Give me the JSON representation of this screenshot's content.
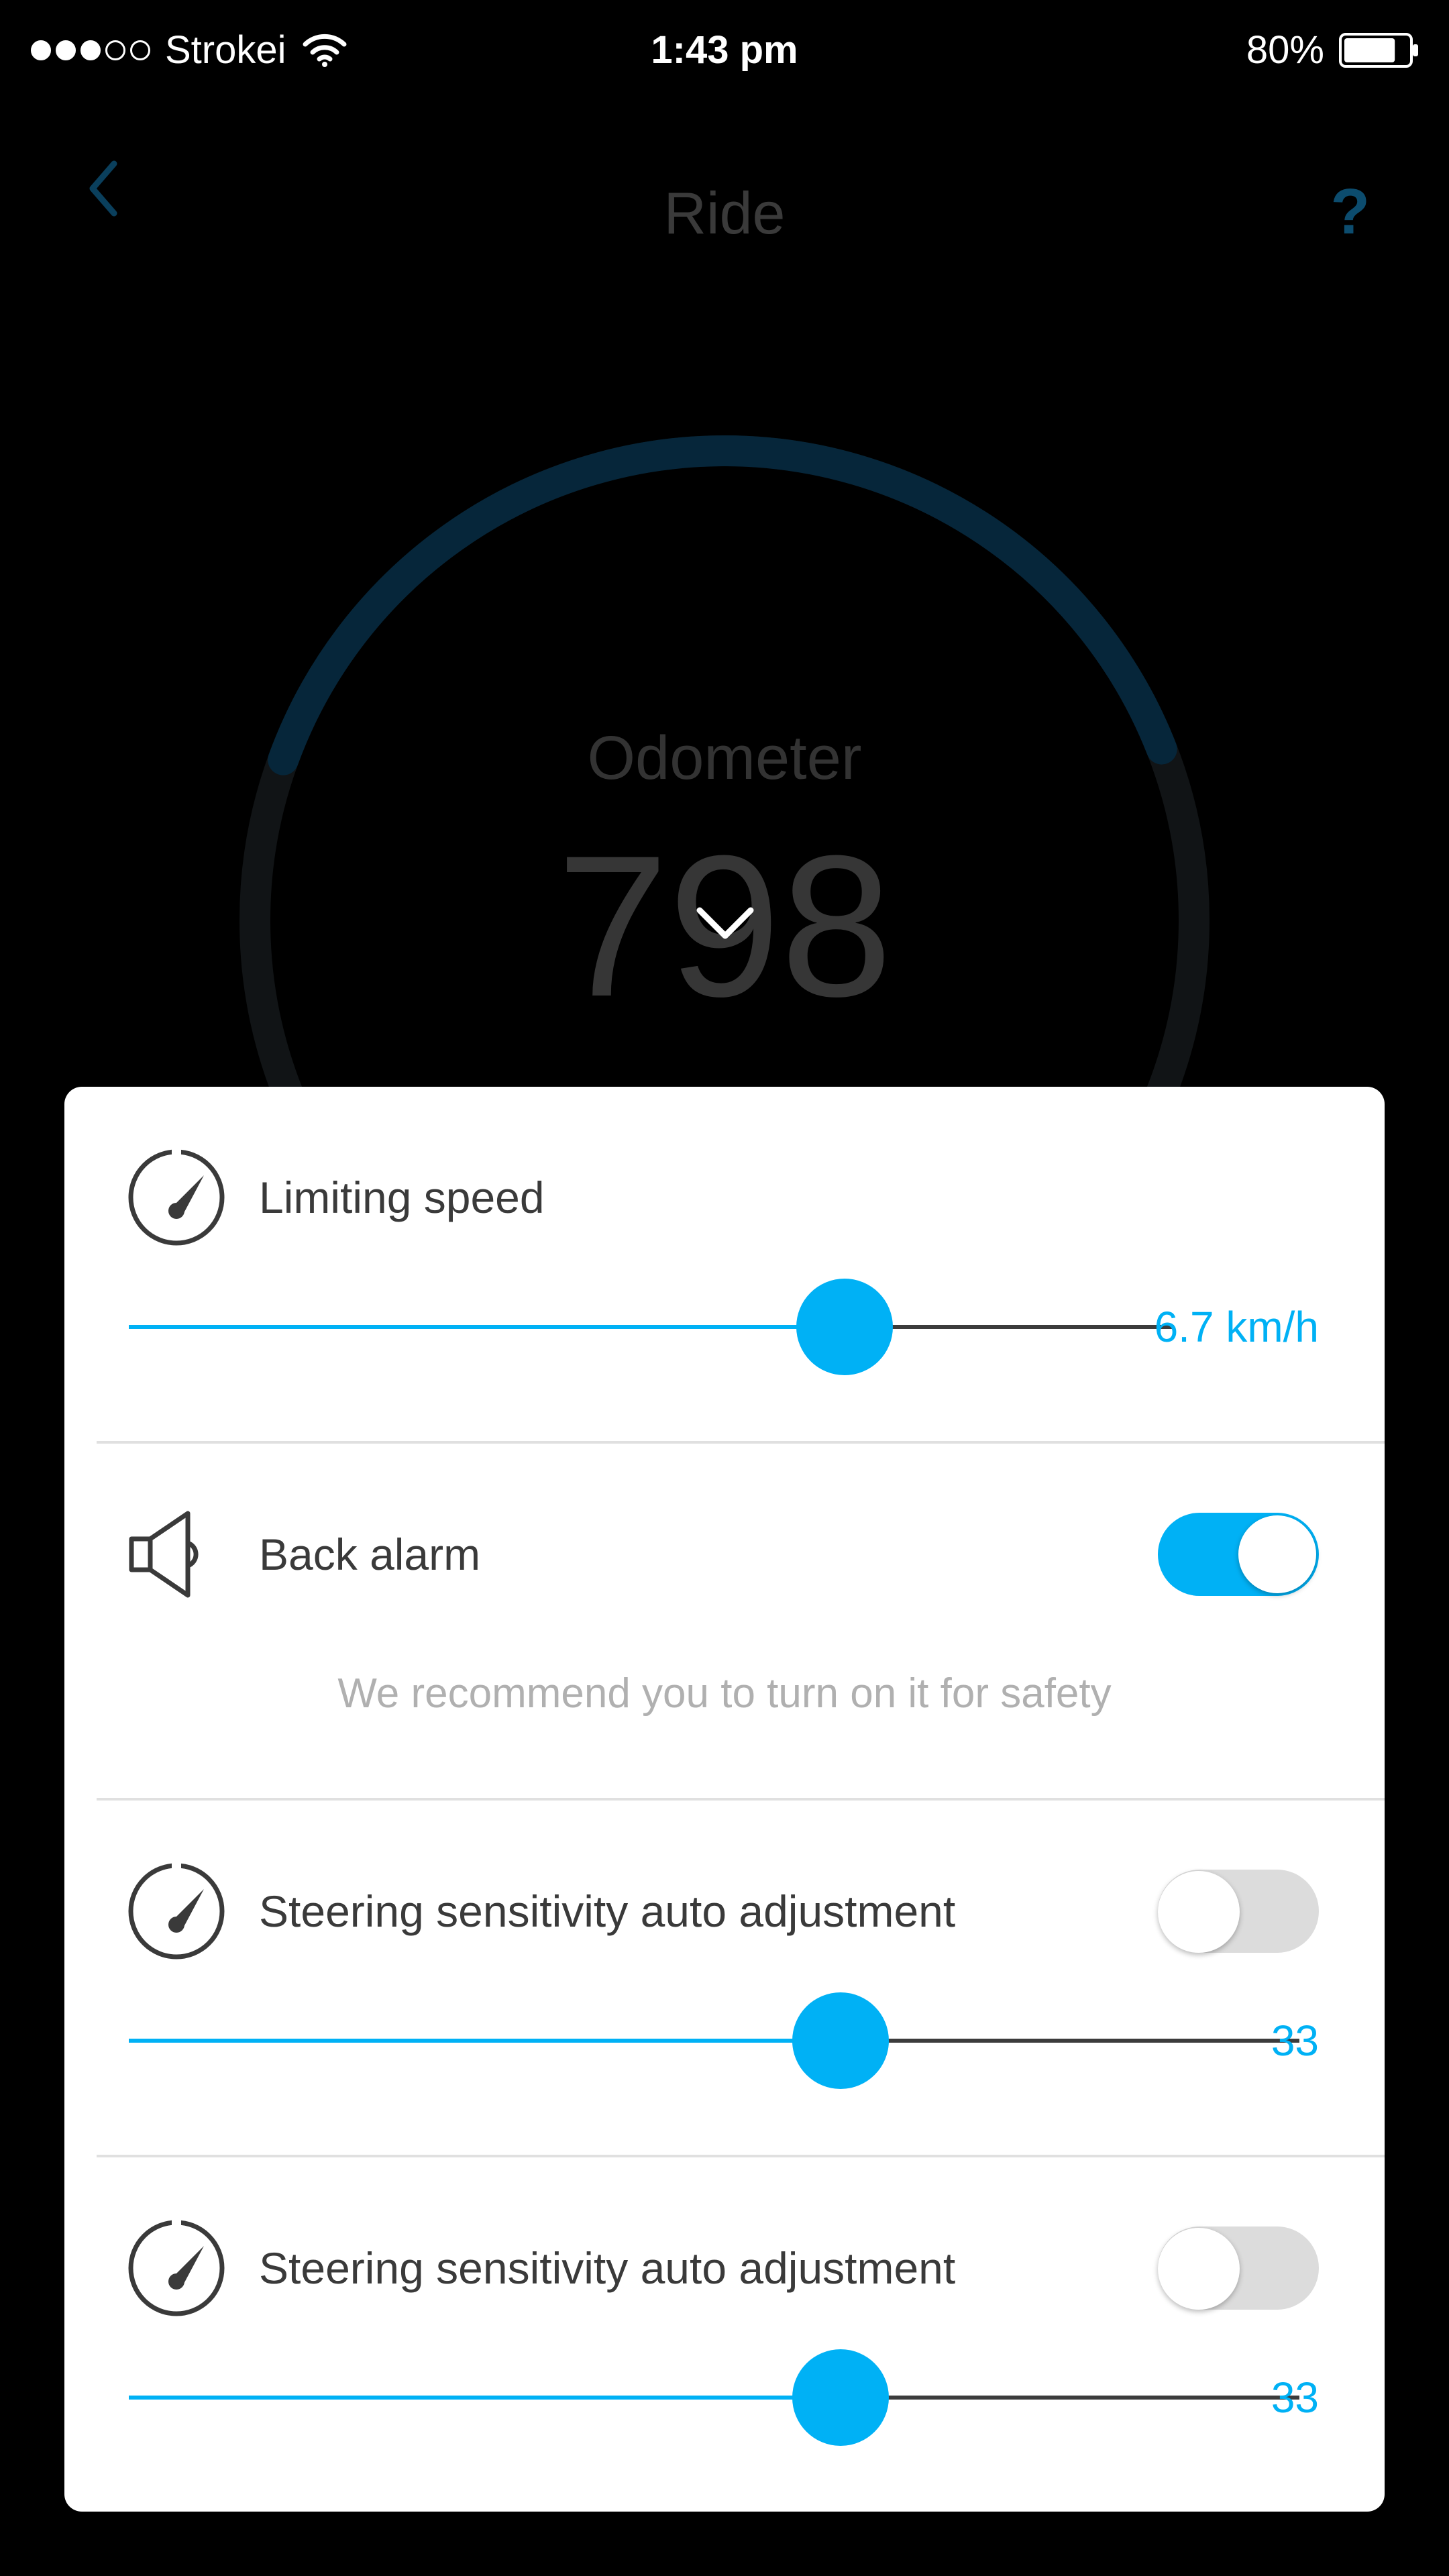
{
  "status_bar": {
    "carrier": "Strokei",
    "signal_bars_filled": 3,
    "signal_bars_total": 5,
    "time": "1:43 pm",
    "battery_percent": "80%",
    "battery_level": 0.8
  },
  "nav": {
    "title": "Ride",
    "back_icon": "chevron-left-icon",
    "help_label": "?"
  },
  "odometer": {
    "label": "Odometer",
    "value": "798",
    "progress_fraction": 0.35,
    "collapse_icon": "chevron-down-icon"
  },
  "settings": {
    "limiting_speed": {
      "icon": "speedometer-icon",
      "label": "Limiting speed",
      "slider_fraction": 0.685,
      "value": "6.7 km/h"
    },
    "back_alarm": {
      "icon": "speaker-icon",
      "label": "Back alarm",
      "enabled": true,
      "hint": "We recommend you to turn on it for safety"
    },
    "steering_1": {
      "icon": "speedometer-icon",
      "label": "Steering sensitivity auto adjustment",
      "enabled": false,
      "slider_fraction": 0.608,
      "value": "33"
    },
    "steering_2": {
      "icon": "speedometer-icon",
      "label": "Steering sensitivity auto adjustment",
      "enabled": false,
      "slider_fraction": 0.608,
      "value": "33"
    }
  },
  "colors": {
    "accent": "#00b1f5",
    "background": "#000000",
    "card": "#ffffff",
    "gauge_track": "#0d2230",
    "gauge_progress": "#062a3c"
  }
}
